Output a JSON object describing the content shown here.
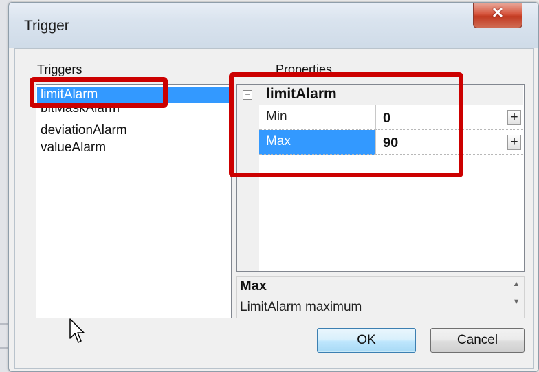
{
  "window": {
    "title": "Trigger",
    "close_symbol": "✕"
  },
  "triggers": {
    "label": "Triggers",
    "items": [
      {
        "label": "limitAlarm",
        "selected": true
      },
      {
        "label": "bitMaskAlarm",
        "selected": false
      },
      {
        "label": "deviationAlarm",
        "selected": false
      },
      {
        "label": "valueAlarm",
        "selected": false
      }
    ]
  },
  "properties": {
    "label": "Properties",
    "category": "limitAlarm",
    "collapse_symbol": "−",
    "rows": [
      {
        "name": "Min",
        "value": "0",
        "button": "+"
      },
      {
        "name": "Max",
        "value": "90",
        "button": "+"
      }
    ]
  },
  "description": {
    "title": "Max",
    "text": "LimitAlarm maximum"
  },
  "buttons": {
    "ok": "OK",
    "cancel": "Cancel"
  },
  "icons": {
    "close": "close-icon",
    "cursor": "mouse-cursor-icon",
    "collapse": "collapse-icon"
  },
  "colors": {
    "selection": "#3399ff",
    "highlight": "#cc0000"
  }
}
